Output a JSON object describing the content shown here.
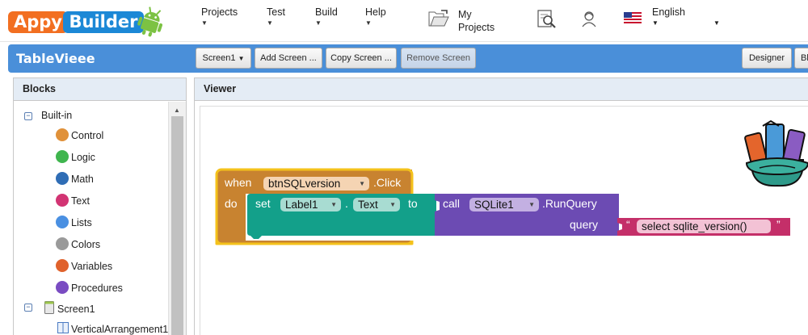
{
  "brand": {
    "part1": "Appy",
    "part2": "Builder",
    "colors": {
      "appy": "#f26f21",
      "builder": "#1c88d6",
      "android": "#7cc243"
    }
  },
  "menu": {
    "projects": "Projects",
    "test": "Test",
    "build": "Build",
    "help": "Help",
    "my_projects_line1": "My",
    "my_projects_line2": "Projects",
    "language": "English",
    "icons": [
      "folder-icon",
      "gallery-search-icon",
      "user-icon",
      "us-flag-icon"
    ]
  },
  "toolbar": {
    "project_name": "TableVieee",
    "screen_select": "Screen1",
    "add_screen": "Add Screen ...",
    "copy_screen": "Copy Screen ...",
    "remove_screen": "Remove Screen",
    "designer": "Designer",
    "blocks": "Bl",
    "color": "#4a8fd9"
  },
  "blocks_panel": {
    "title": "Blocks",
    "builtin_label": "Built-in",
    "categories": [
      {
        "label": "Control",
        "color": "#e0913a"
      },
      {
        "label": "Logic",
        "color": "#3fb54e"
      },
      {
        "label": "Math",
        "color": "#2f6db5"
      },
      {
        "label": "Text",
        "color": "#d23473"
      },
      {
        "label": "Lists",
        "color": "#4a90e2"
      },
      {
        "label": "Colors",
        "color": "#9a9a9a"
      },
      {
        "label": "Variables",
        "color": "#e0622c"
      },
      {
        "label": "Procedures",
        "color": "#7a4cc2"
      }
    ],
    "screen_label": "Screen1",
    "child_label": "VerticalArrangement1"
  },
  "viewer": {
    "title": "Viewer",
    "event_block": {
      "when": "when",
      "component": "btnSQLversion",
      "event": ".Click",
      "do": "do",
      "color": "#c88330"
    },
    "set_block": {
      "set": "set",
      "component": "Label1",
      "dot": ".",
      "property": "Text",
      "to": "to",
      "color": "#13a08a"
    },
    "call_block": {
      "call": "call",
      "component": "SQLite1",
      "method": ".RunQuery",
      "param": "query",
      "color": "#6c4bb3"
    },
    "text_block": {
      "open_quote": "“",
      "value": "select sqlite_version()",
      "close_quote": "”",
      "color": "#c42f69"
    }
  }
}
